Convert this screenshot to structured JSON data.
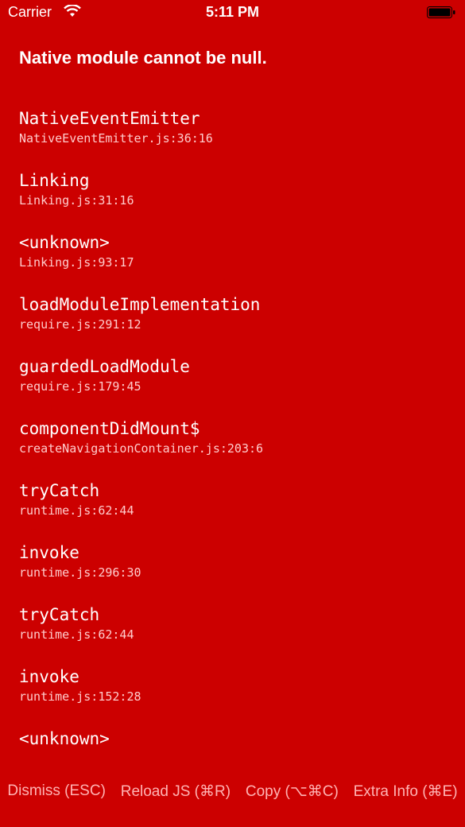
{
  "status_bar": {
    "carrier": "Carrier",
    "time": "5:11 PM"
  },
  "error": {
    "message": "Native module cannot be null."
  },
  "stack": [
    {
      "fn": "NativeEventEmitter",
      "loc": "NativeEventEmitter.js:36:16"
    },
    {
      "fn": "Linking",
      "loc": "Linking.js:31:16"
    },
    {
      "fn": "<unknown>",
      "loc": "Linking.js:93:17"
    },
    {
      "fn": "loadModuleImplementation",
      "loc": "require.js:291:12"
    },
    {
      "fn": "guardedLoadModule",
      "loc": "require.js:179:45"
    },
    {
      "fn": "componentDidMount$",
      "loc": "createNavigationContainer.js:203:6"
    },
    {
      "fn": "tryCatch",
      "loc": "runtime.js:62:44"
    },
    {
      "fn": "invoke",
      "loc": "runtime.js:296:30"
    },
    {
      "fn": "tryCatch",
      "loc": "runtime.js:62:44"
    },
    {
      "fn": "invoke",
      "loc": "runtime.js:152:28"
    },
    {
      "fn": "<unknown>",
      "loc": ""
    }
  ],
  "buttons": {
    "dismiss": "Dismiss (ESC)",
    "reload": "Reload JS (⌘R)",
    "copy": "Copy (⌥⌘C)",
    "extra": "Extra Info (⌘E)"
  },
  "colors": {
    "background": "#cc0000",
    "text": "#ffffff",
    "button_text": "#ffb3b3"
  },
  "icons": [
    "wifi-icon",
    "battery-icon"
  ]
}
